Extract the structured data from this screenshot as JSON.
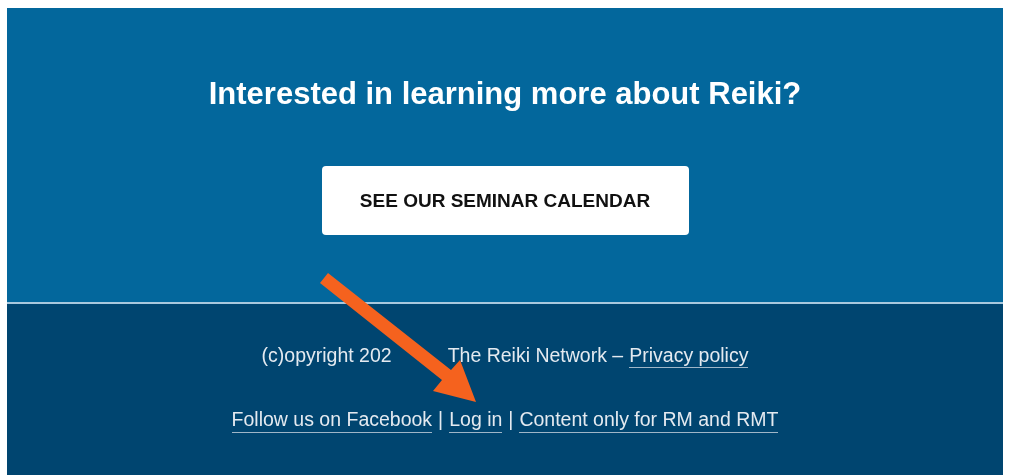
{
  "cta": {
    "heading": "Interested in learning more about Reiki?",
    "button": "SEE OUR SEMINAR CALENDAR"
  },
  "footer": {
    "copyright_start": "(c)opyright 202",
    "copyright_end": "The Reiki Network –",
    "privacy_link": "Privacy policy",
    "separator": "|",
    "links": [
      "Follow us on Facebook",
      "Log in",
      "Content only for RM and RMT"
    ]
  }
}
